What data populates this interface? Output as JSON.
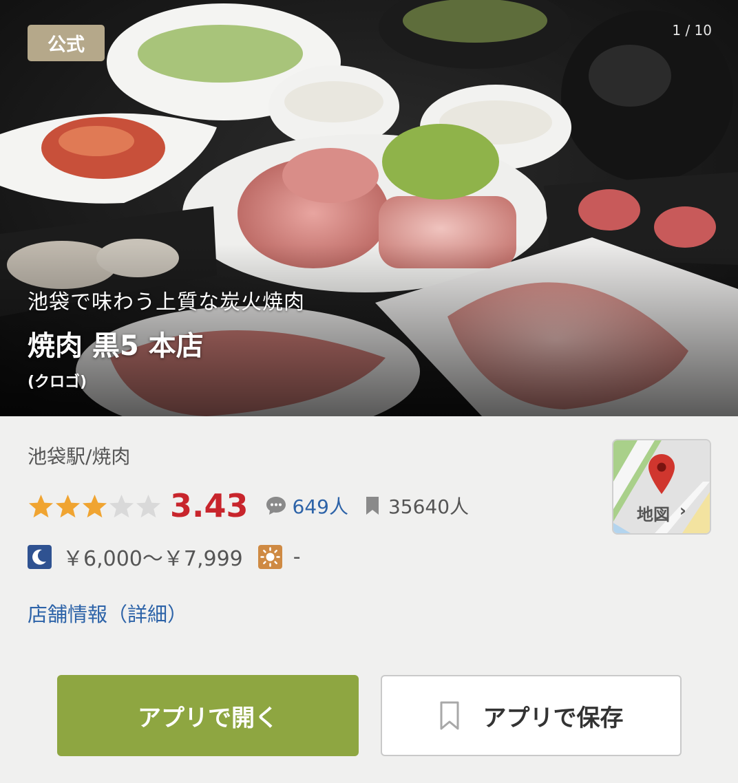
{
  "hero": {
    "badge": "公式",
    "counter": "1 / 10",
    "tagline": "池袋で味わう上質な炭火焼肉",
    "shop_name": "焼肉 黒5 本店",
    "shop_kana": "(クロゴ)"
  },
  "info": {
    "area_genre": "池袋駅/焼肉",
    "rating": 3.43,
    "rating_text": "3.43",
    "stars_filled": 3,
    "stars_total": 5,
    "review_count": "649人",
    "save_count": "35640人",
    "dinner_price": "￥6,000～￥7,999",
    "lunch_price": "-",
    "shop_info_link": "店舗情報（詳細）"
  },
  "map": {
    "label": "地図",
    "chevron": "›"
  },
  "actions": {
    "open_app": "アプリで開く",
    "save_app": "アプリで保存"
  },
  "colors": {
    "rating": "#c8252c",
    "link": "#2d63a8",
    "open_button": "#8ea641",
    "star_on": "#f0a431",
    "star_off": "#d9d9d9",
    "badge": "#b5a88a"
  },
  "icons": {
    "review": "speech-bubble-icon",
    "save": "bookmark-icon",
    "dinner": "moon-icon",
    "lunch": "sun-icon",
    "map": "map-pin-icon"
  }
}
